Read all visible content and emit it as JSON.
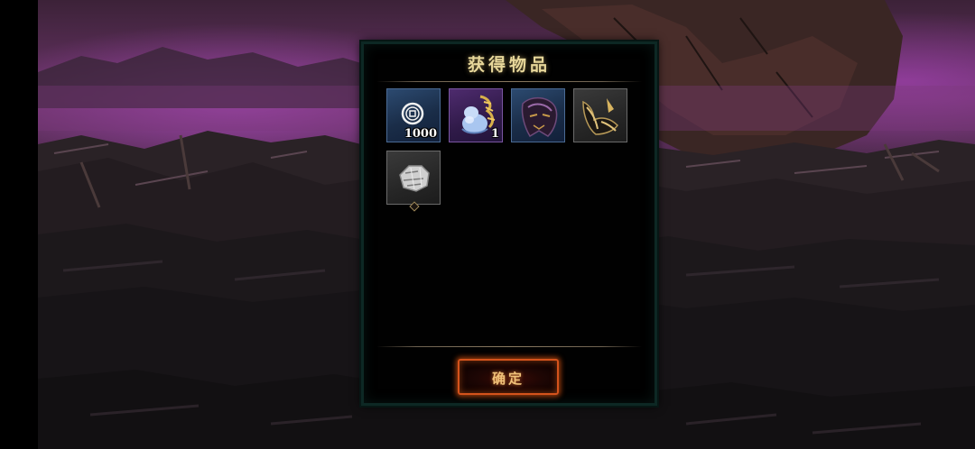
{
  "dialog": {
    "title": "获得物品",
    "confirm_label": "确定"
  },
  "items": [
    {
      "name": "copper-coin",
      "count": "1000",
      "rarity": "blue"
    },
    {
      "name": "blue-spirit-gourd",
      "count": "1",
      "rarity": "purple"
    },
    {
      "name": "dark-demon-mask",
      "count": "",
      "rarity": "blue"
    },
    {
      "name": "golden-horn-helmet",
      "count": "",
      "rarity": "gray"
    },
    {
      "name": "silver-ore",
      "count": "",
      "rarity": "gray"
    }
  ],
  "colors": {
    "title": "#e7d79a",
    "button_border": "#d4531c",
    "panel_border": "#0d2824",
    "sky_purple": "#6a3468"
  }
}
